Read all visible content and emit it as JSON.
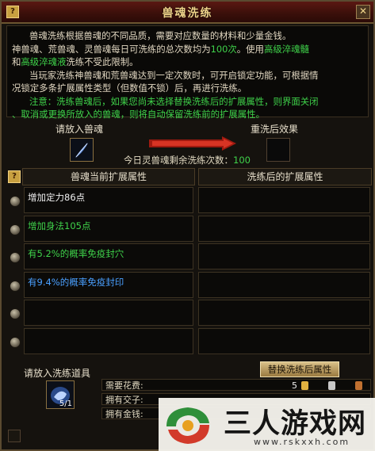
{
  "window": {
    "title": "兽魂洗练",
    "help_glyph": "?",
    "close_glyph": "✕"
  },
  "description": {
    "line1": "兽魂洗练根据兽魂的不同品质，需要对应数量的材料和少量金钱。",
    "line2a": "神兽魂、荒兽魂、灵兽魂每日可洗练的总次数均为",
    "line2b": "100次",
    "line2c": "。使用",
    "line2d": "高级淬魂髓",
    "line3a": "和",
    "line3b": "高级淬魂液",
    "line3c": "洗练不受此限制。",
    "line4": "当玩家洗练神兽魂和荒兽魂达到一定次数时，可开启锁定功能，可根据情",
    "line5": "况锁定多条扩展属性类型（但数值不锁）后，再进行洗练。",
    "line6": "注意：洗练兽魂后，如果您尚未选择替换洗练后的扩展属性，则界面关闭",
    "line7": "、取消或更换所放入的兽魂，则将自动保留洗练前的扩展属性。"
  },
  "slots": {
    "put_soul_label": "请放入兽魂",
    "result_label": "重洗后效果",
    "remaining_prefix": "今日灵兽魂剩余洗练次数：",
    "remaining_count": "100"
  },
  "columns": {
    "current_header": "兽魂当前扩展属性",
    "after_header": "洗练后的扩展属性"
  },
  "attributes": [
    {
      "text": "增加定力86点",
      "color": "#f0f0f0"
    },
    {
      "text": "增加身法105点",
      "color": "#3fd24a"
    },
    {
      "text": "有5.2%的概率免疫封穴",
      "color": "#3fd24a"
    },
    {
      "text": "有9.4%的概率免疫封印",
      "color": "#4aa0ff"
    },
    {
      "text": "",
      "color": "#f0f0f0"
    },
    {
      "text": "",
      "color": "#f0f0f0"
    }
  ],
  "tool": {
    "label": "请放入洗练道具",
    "count": "5/1"
  },
  "replace_button": "替换洗练后属性",
  "costs": {
    "fee_label": "需要花费:",
    "fee_value": "5",
    "have_jiaozi_label": "拥有交子:",
    "have_money_label": "拥有金钱:"
  },
  "watermark": {
    "name": "三人游戏网",
    "url": "www.rskxxh.com"
  }
}
